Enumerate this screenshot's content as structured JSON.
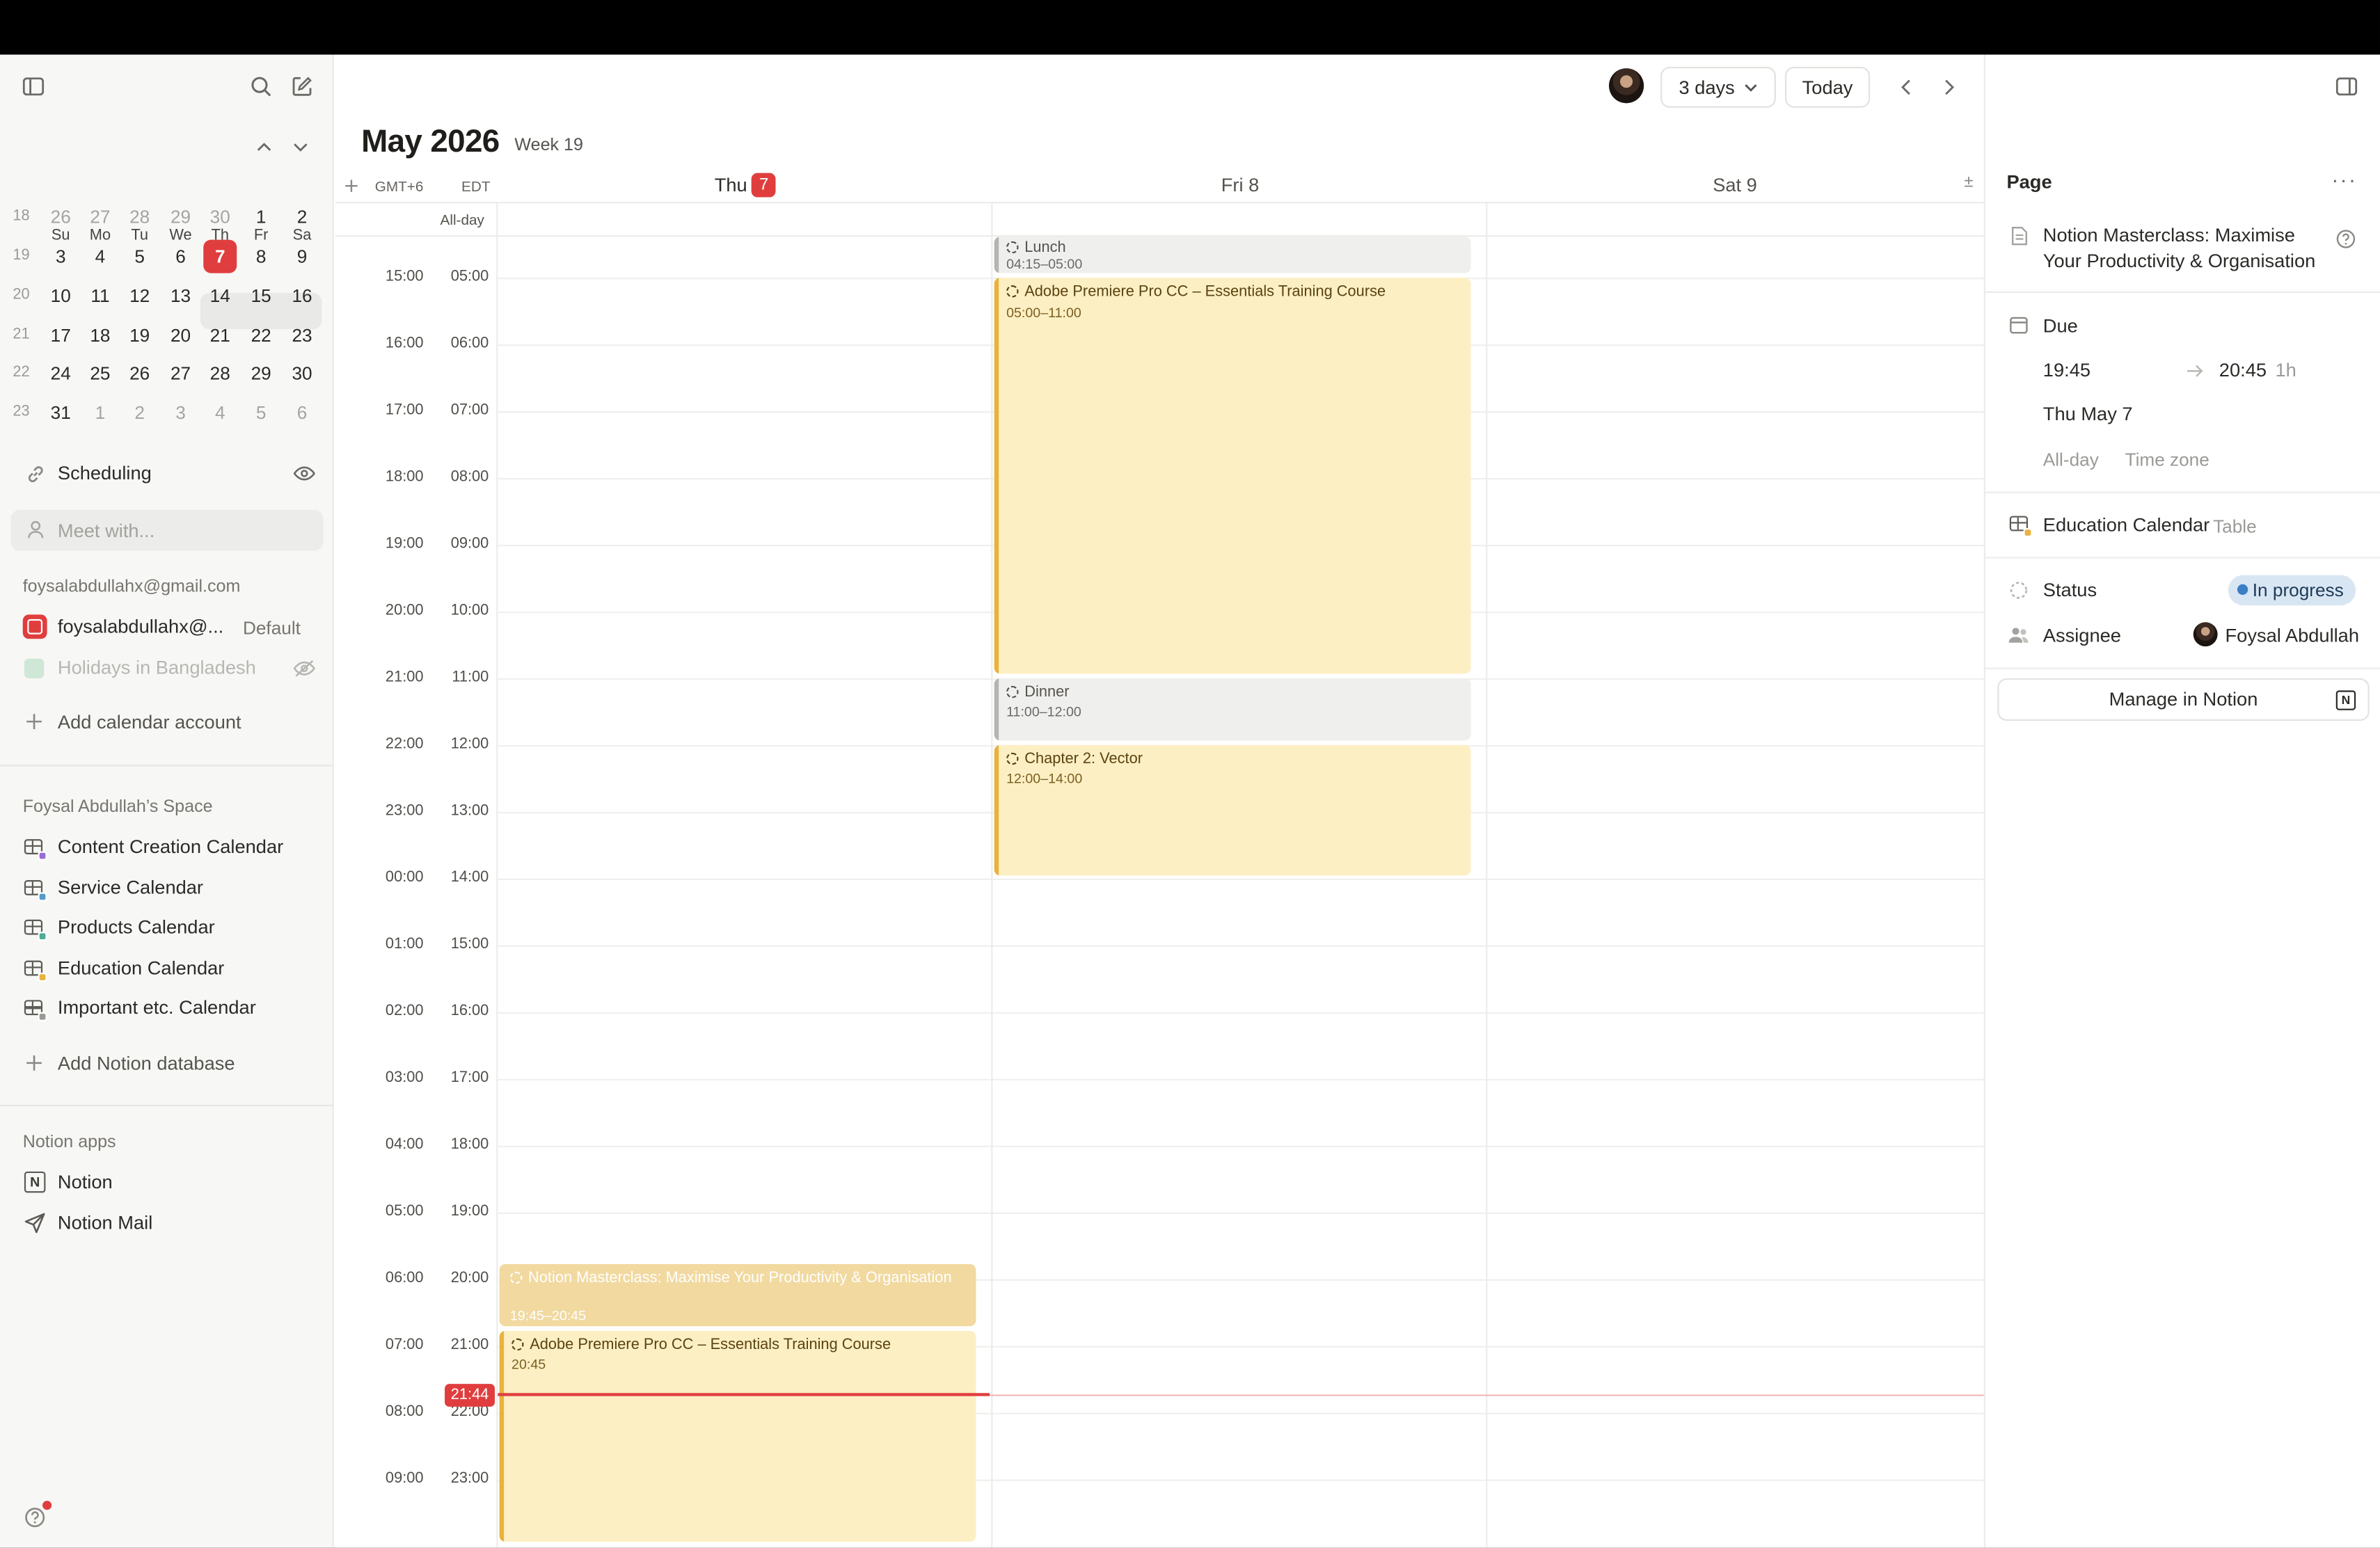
{
  "sidebar": {
    "mini_calendar": {
      "weekday_headers": [
        "Su",
        "Mo",
        "Tu",
        "We",
        "Th",
        "Fr",
        "Sa"
      ],
      "weeks": [
        {
          "week": "18",
          "days": [
            "26",
            "27",
            "28",
            "29",
            "30",
            "1",
            "2"
          ]
        },
        {
          "week": "19",
          "days": [
            "3",
            "4",
            "5",
            "6",
            "7",
            "8",
            "9"
          ]
        },
        {
          "week": "20",
          "days": [
            "10",
            "11",
            "12",
            "13",
            "14",
            "15",
            "16"
          ]
        },
        {
          "week": "21",
          "days": [
            "17",
            "18",
            "19",
            "20",
            "21",
            "22",
            "23"
          ]
        },
        {
          "week": "22",
          "days": [
            "24",
            "25",
            "26",
            "27",
            "28",
            "29",
            "30"
          ]
        },
        {
          "week": "23",
          "days": [
            "31",
            "1",
            "2",
            "3",
            "4",
            "5",
            "6"
          ]
        }
      ],
      "today": "7"
    },
    "scheduling_label": "Scheduling",
    "meet_placeholder": "Meet with...",
    "account_email": "foysalabdullahx@gmail.com",
    "calendars": [
      {
        "name": "foysalabdullahx@...",
        "tag": "Default",
        "color": "#e03e3e"
      },
      {
        "name": "Holidays in Bangladesh",
        "color": "#a8d5b5",
        "hidden": true
      }
    ],
    "add_calendar_account": "Add calendar account",
    "space_title": "Foysal Abdullah’s Space",
    "databases": [
      {
        "name": "Content Creation Calendar",
        "color": "#9a6dd7"
      },
      {
        "name": "Service Calendar",
        "color": "#529cca"
      },
      {
        "name": "Products Calendar",
        "color": "#4dab9a"
      },
      {
        "name": "Education Calendar",
        "color": "#e9b23e"
      },
      {
        "name": "Important etc. Calendar",
        "color": "#9b9a97"
      }
    ],
    "add_notion_database": "Add Notion database",
    "apps_title": "Notion apps",
    "apps": [
      "Notion",
      "Notion Mail"
    ]
  },
  "toolbar": {
    "view_label": "3 days",
    "today_label": "Today"
  },
  "calendar": {
    "month_title": "May 2026",
    "week_label": "Week 19",
    "tz_primary": "GMT+6",
    "tz_secondary": "EDT",
    "allday_label": "All-day",
    "day_headers": [
      {
        "name": "Thu",
        "num": "7",
        "is_today": true
      },
      {
        "name": "Fri 8"
      },
      {
        "name": "Sat 9"
      }
    ],
    "rows": [
      {
        "gmt": "15:00",
        "edt": "05:00"
      },
      {
        "gmt": "16:00",
        "edt": "06:00"
      },
      {
        "gmt": "17:00",
        "edt": "07:00"
      },
      {
        "gmt": "18:00",
        "edt": "08:00"
      },
      {
        "gmt": "19:00",
        "edt": "09:00"
      },
      {
        "gmt": "20:00",
        "edt": "10:00"
      },
      {
        "gmt": "21:00",
        "edt": "11:00"
      },
      {
        "gmt": "22:00",
        "edt": "12:00"
      },
      {
        "gmt": "23:00",
        "edt": "13:00"
      },
      {
        "gmt": "00:00",
        "edt": "14:00"
      },
      {
        "gmt": "01:00",
        "edt": "15:00"
      },
      {
        "gmt": "02:00",
        "edt": "16:00"
      },
      {
        "gmt": "03:00",
        "edt": "17:00"
      },
      {
        "gmt": "04:00",
        "edt": "18:00"
      },
      {
        "gmt": "05:00",
        "edt": "19:00"
      },
      {
        "gmt": "06:00",
        "edt": "20:00"
      },
      {
        "gmt": "07:00",
        "edt": "21:00"
      },
      {
        "gmt": "08:00",
        "edt": "22:00"
      },
      {
        "gmt": "09:00",
        "edt": "23:00"
      }
    ],
    "now_time": "21:44",
    "events": [
      {
        "title": "Lunch",
        "time": "04:15–05:00"
      },
      {
        "title": "Adobe Premiere Pro CC – Essentials Training Course",
        "time": "05:00–11:00"
      },
      {
        "title": "Dinner",
        "time": "11:00–12:00"
      },
      {
        "title": "Chapter 2: Vector",
        "time": "12:00–14:00"
      },
      {
        "title": "Notion Masterclass: Maximise Your Productivity & Organisation",
        "time": "19:45–20:45"
      },
      {
        "title": "Adobe Premiere Pro CC – Essentials Training Course",
        "time": "20:45"
      }
    ]
  },
  "panel": {
    "header": "Page",
    "page_title": "Notion Masterclass: Maximise Your Productivity & Organisation",
    "due_label": "Due",
    "start_time": "19:45",
    "end_time": "20:45",
    "duration": "1h",
    "date": "Thu May 7",
    "allday_option": "All-day",
    "timezone_option": "Time zone",
    "database_name": "Education Calendar",
    "database_view": "Table",
    "status_label": "Status",
    "status_value": "In progress",
    "assignee_label": "Assignee",
    "assignee_value": "Foysal Abdullah",
    "manage_button": "Manage in Notion"
  }
}
